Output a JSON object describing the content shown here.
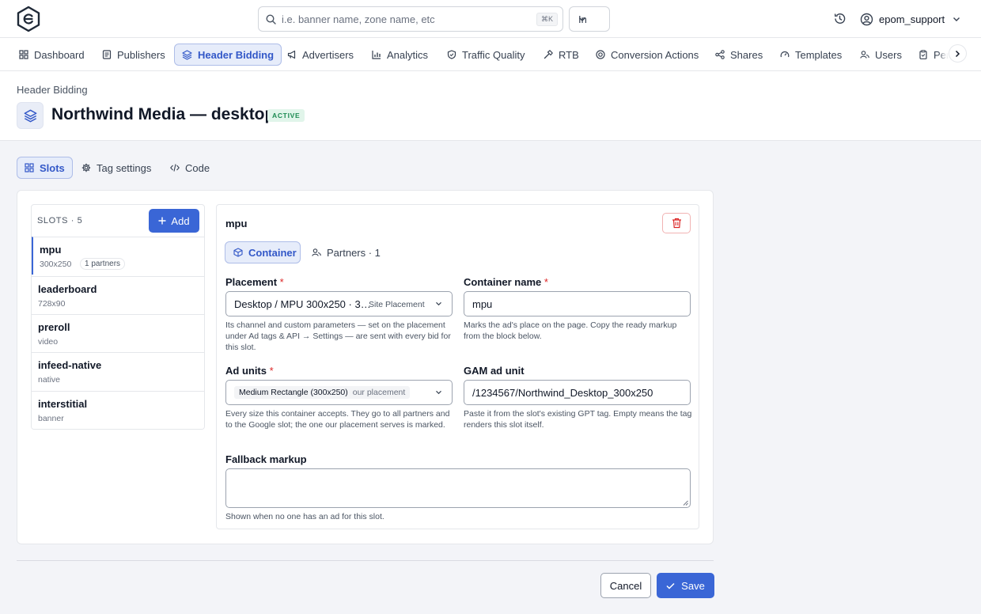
{
  "topbar": {
    "search_placeholder": "i.e. banner name, zone name, etc",
    "search_shortcut": "⌘K",
    "scope_value": "In",
    "username": "epom_support"
  },
  "nav": {
    "items": [
      {
        "label": "Dashboard",
        "icon": "grid-icon"
      },
      {
        "label": "Publishers",
        "icon": "book-icon"
      },
      {
        "label": "Header Bidding",
        "icon": "layers-icon",
        "active": true
      },
      {
        "label": "Advertisers",
        "icon": "megaphone-icon"
      },
      {
        "label": "Analytics",
        "icon": "bar-chart-icon"
      },
      {
        "label": "Traffic Quality",
        "icon": "shield-icon"
      },
      {
        "label": "RTB",
        "icon": "hammer-icon"
      },
      {
        "label": "Conversion Actions",
        "icon": "target-icon"
      },
      {
        "label": "Shares",
        "icon": "share-icon"
      },
      {
        "label": "Templates",
        "icon": "gauge-icon"
      },
      {
        "label": "Users",
        "icon": "users-icon"
      },
      {
        "label": "Pen",
        "icon": "clipboard-icon"
      }
    ]
  },
  "header": {
    "breadcrumb": "Header Bidding",
    "title": "Northwind Media — desktop",
    "status": "ACTIVE"
  },
  "subtabs": [
    {
      "label": "Slots",
      "icon": "grid-icon",
      "active": true
    },
    {
      "label": "Tag settings",
      "icon": "gear-icon"
    },
    {
      "label": "Code",
      "icon": "code-icon"
    }
  ],
  "slots": {
    "heading": "SLOTS · 5",
    "add_label": "Add",
    "items": [
      {
        "name": "mpu",
        "meta": "300x250",
        "pill": "1 partners"
      },
      {
        "name": "leaderboard",
        "meta": "728x90"
      },
      {
        "name": "preroll",
        "meta": "video"
      },
      {
        "name": "infeed-native",
        "meta": "native"
      },
      {
        "name": "interstitial",
        "meta": "banner"
      }
    ]
  },
  "editor": {
    "title": "mpu",
    "tab_container": "Container",
    "tab_partners": "Partners · 1",
    "placement": {
      "label": "Placement",
      "required": "*",
      "value": "Desktop / MPU 300x250 · 3…",
      "tag": "Site Placement",
      "help": "Its channel and custom parameters — set on the placement under Ad tags & API → Settings — are sent with every bid for this slot."
    },
    "container_name": {
      "label": "Container name",
      "required": "*",
      "value": "mpu",
      "help": "Marks the ad's place on the page. Copy the ready markup from the block below."
    },
    "ad_units": {
      "label": "Ad units",
      "required": "*",
      "chip": "Medium Rectangle (300x250)",
      "chip_note": "our placement",
      "help": "Every size this container accepts. They go to all partners and to the Google slot; the one our placement serves is marked."
    },
    "gam_ad_unit": {
      "label": "GAM ad unit",
      "value": "/1234567/Northwind_Desktop_300x250",
      "help": "Paste it from the slot's existing GPT tag. Empty means the tag renders this slot itself."
    },
    "fallback": {
      "label": "Fallback markup",
      "value": "",
      "help": "Shown when no one has an ad for this slot."
    }
  },
  "footer": {
    "cancel_label": "Cancel",
    "save_label": "Save"
  }
}
